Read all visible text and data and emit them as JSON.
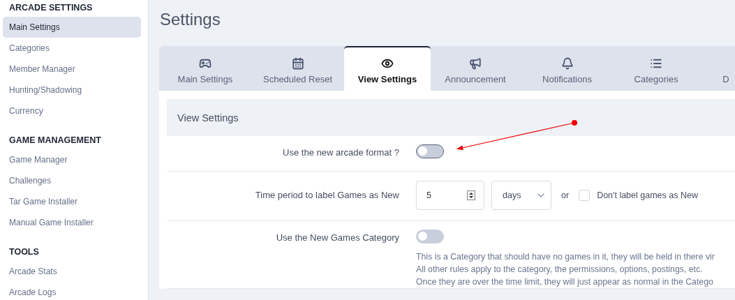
{
  "sidebar": {
    "sections": [
      {
        "heading": "ARCADE SETTINGS",
        "items": [
          {
            "label": "Main Settings",
            "selected": true
          },
          {
            "label": "Categories",
            "selected": false
          },
          {
            "label": "Member Manager",
            "selected": false
          },
          {
            "label": "Hunting/Shadowing",
            "selected": false
          },
          {
            "label": "Currency",
            "selected": false
          }
        ]
      },
      {
        "heading": "GAME MANAGEMENT",
        "items": [
          {
            "label": "Game Manager",
            "selected": false
          },
          {
            "label": "Challenges",
            "selected": false
          },
          {
            "label": "Tar Game Installer",
            "selected": false
          },
          {
            "label": "Manual Game Installer",
            "selected": false
          }
        ]
      },
      {
        "heading": "TOOLS",
        "items": [
          {
            "label": "Arcade Stats",
            "selected": false
          },
          {
            "label": "Arcade Logs",
            "selected": false
          }
        ]
      }
    ]
  },
  "page_title": "Settings",
  "tabs": [
    {
      "label": "Main Settings",
      "kind": "gamepad",
      "selected": false
    },
    {
      "label": "Scheduled Reset",
      "kind": "calendar",
      "selected": false
    },
    {
      "label": "View Settings",
      "kind": "eye",
      "selected": true
    },
    {
      "label": "Announcement",
      "kind": "megaphone",
      "selected": false
    },
    {
      "label": "Notifications",
      "kind": "bell",
      "selected": false
    },
    {
      "label": "Categories",
      "kind": "list",
      "selected": false
    },
    {
      "label": "D",
      "kind": "none",
      "selected": false
    }
  ],
  "section_title": "View Settings",
  "settings": [
    {
      "kind": "toggle",
      "label": "Use the new arcade format ?",
      "on": false,
      "focused": true
    },
    {
      "kind": "period",
      "label": "Time period to label Games as New",
      "value": "5",
      "unit": "days",
      "or_text": "or",
      "checkbox": {
        "label": "Don't label games as New",
        "checked": false
      }
    },
    {
      "kind": "toggle",
      "label": "Use the New Games Category",
      "on": false,
      "focused": false,
      "description": [
        "This is a Category that should have no games in it, they will be held in there vir",
        "All other rules apply to the category, the permissions, options, postings, etc.",
        "Once they are over the time limit, they will just appear as normal in the Catego"
      ]
    }
  ]
}
